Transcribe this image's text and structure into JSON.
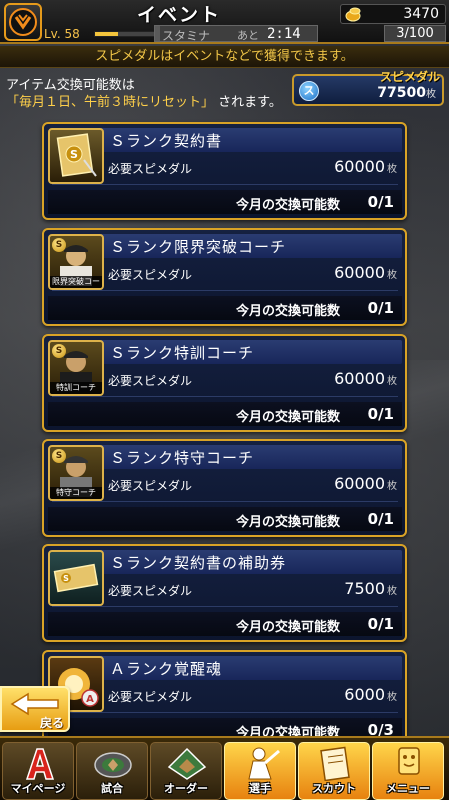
{
  "header": {
    "title": "イベント",
    "level": "Lv. 58",
    "stamina_label": "スタミナ",
    "stamina_after": "あと",
    "stamina_timer": "2:14",
    "stamina_count": "3/100",
    "coins": "3470"
  },
  "notice": "スピメダルはイベントなどで獲得できます。",
  "info": {
    "line1": "アイテム交換可能数は",
    "line2_highlight": "「毎月１日、午前３時にリセット」",
    "line2_rest": "されます。"
  },
  "medal": {
    "title": "スピメダル",
    "icon": "ス",
    "value": "77500",
    "unit": "枚"
  },
  "common": {
    "req_label": "必要スピメダル",
    "unit": "枚",
    "limit_label": "今月の交換可能数"
  },
  "items": [
    {
      "title": "Ｓランク契約書",
      "thumb_caption": "",
      "cost": "60000",
      "limit": "0/1"
    },
    {
      "title": "Ｓランク限界突破コーチ",
      "thumb_caption": "限界突破コーチ",
      "cost": "60000",
      "limit": "0/1"
    },
    {
      "title": "Ｓランク特訓コーチ",
      "thumb_caption": "特訓コーチ",
      "cost": "60000",
      "limit": "0/1"
    },
    {
      "title": "Ｓランク特守コーチ",
      "thumb_caption": "特守コーチ",
      "cost": "60000",
      "limit": "0/1"
    },
    {
      "title": "Ｓランク契約書の補助券",
      "thumb_caption": "",
      "cost": "7500",
      "limit": "0/1"
    },
    {
      "title": "Ａランク覚醒魂",
      "thumb_caption": "",
      "cost": "6000",
      "limit": "0/3"
    }
  ],
  "back_label": "戻る",
  "nav": [
    {
      "label": "マイページ",
      "icon": "mypage-icon"
    },
    {
      "label": "試合",
      "icon": "stadium-icon"
    },
    {
      "label": "オーダー",
      "icon": "field-icon"
    },
    {
      "label": "選手",
      "icon": "player-icon"
    },
    {
      "label": "スカウト",
      "icon": "scout-icon"
    },
    {
      "label": "メニュー",
      "icon": "menu-icon"
    }
  ],
  "colors": {
    "accent_gold": "#d9a326",
    "highlight_yellow": "#ffd04a",
    "card_navy": "#152141"
  },
  "progress": {
    "exp_fraction": 0.25,
    "stamina_fraction": 0.03
  }
}
